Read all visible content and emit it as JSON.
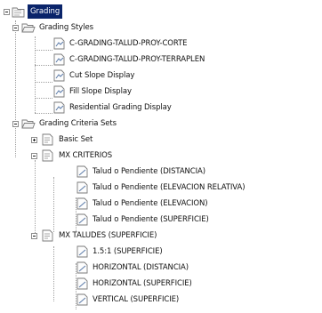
{
  "tree": {
    "root": {
      "label": "Grading",
      "expanded": true,
      "selected": true,
      "icon": "folder-clipboard-icon"
    },
    "grading_styles": {
      "label": "Grading Styles",
      "expanded": true,
      "icon": "folder-open-icon",
      "items": [
        {
          "label": "C-GRADING-TALUD-PROY-CORTE",
          "icon": "grading-style-icon"
        },
        {
          "label": "C-GRADING-TALUD-PROY-TERRAPLEN",
          "icon": "grading-style-icon"
        },
        {
          "label": "Cut Slope Display",
          "icon": "grading-style-icon"
        },
        {
          "label": "Fill Slope Display",
          "icon": "grading-style-icon"
        },
        {
          "label": "Residential Grading Display",
          "icon": "grading-style-icon"
        }
      ]
    },
    "criteria_sets": {
      "label": "Grading Criteria Sets",
      "expanded": true,
      "icon": "folder-open-icon",
      "sets": [
        {
          "label": "Basic Set",
          "expanded": false,
          "icon": "criteria-set-icon",
          "items": []
        },
        {
          "label": "MX CRITERIOS",
          "expanded": true,
          "icon": "criteria-set-icon",
          "items": [
            {
              "label": "Talud o Pendiente (DISTANCIA)",
              "icon": "criteria-icon"
            },
            {
              "label": "Talud o Pendiente (ELEVACION RELATIVA)",
              "icon": "criteria-icon"
            },
            {
              "label": "Talud o Pendiente (ELEVACION)",
              "icon": "criteria-icon"
            },
            {
              "label": "Talud o Pendiente (SUPERFICIE)",
              "icon": "criteria-icon"
            }
          ]
        },
        {
          "label": "MX TALUDES (SUPERFICIE)",
          "expanded": true,
          "icon": "criteria-set-icon",
          "items": [
            {
              "label": "1.5:1  (SUPERFICIE)",
              "icon": "criteria-icon"
            },
            {
              "label": "HORIZONTAL (DISTANCIA)",
              "icon": "criteria-icon"
            },
            {
              "label": "HORIZONTAL (SUPERFICIE)",
              "icon": "criteria-icon"
            },
            {
              "label": "VERTICAL  (SUPERFICIE)",
              "icon": "criteria-icon"
            }
          ]
        }
      ]
    }
  }
}
